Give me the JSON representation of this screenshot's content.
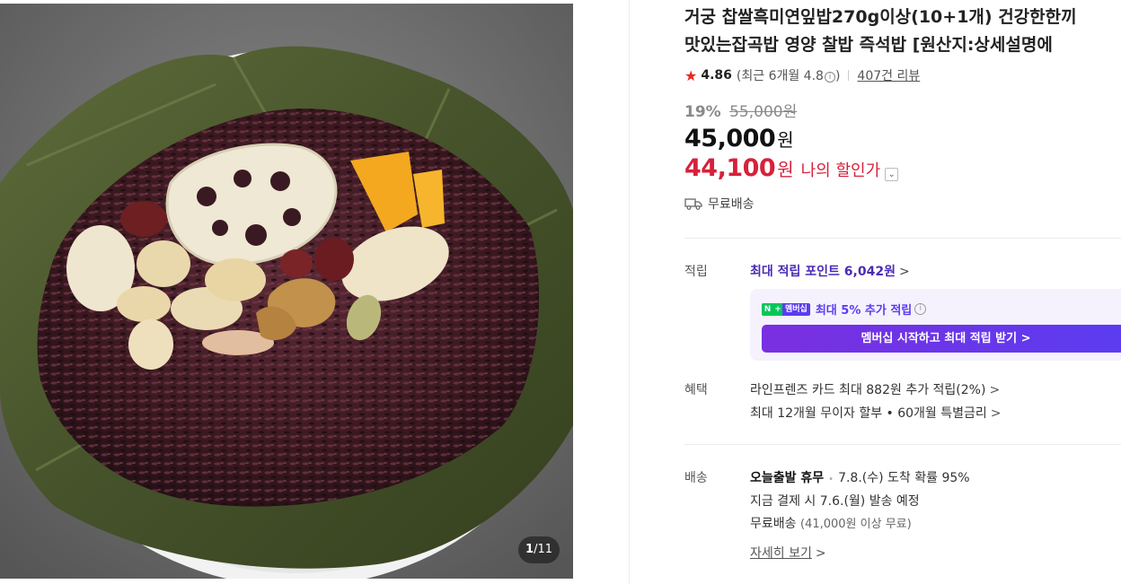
{
  "gallery": {
    "image_desc_icon": "lotus-leaf-rice-photo",
    "counter_current": "1",
    "counter_total": "/11"
  },
  "product": {
    "title_line1": "거궁 찹쌀흑미연잎밥270g이상(10+1개) 건강한한끼",
    "title_line2": "맛있는잡곡밥 영양 찰밥 즉석밥 [원산지:상세설명에",
    "rating": {
      "icon": "star-icon",
      "score": "4.86",
      "recent_prefix": "(최근 6개월 4.8",
      "recent_suffix": ")",
      "info_icon": "i",
      "review_count": "407건 리뷰"
    },
    "discount_rate": "19%",
    "original_price": "55,000원",
    "price": "45,000",
    "price_unit": "원",
    "my_price": "44,100",
    "my_price_unit": "원",
    "my_price_label": "나의 할인가",
    "shipping_free": "무료배송"
  },
  "points": {
    "label": "적립",
    "max_points_text": "최대 적립 포인트 6,042원",
    "chevron": ">",
    "member_badge_n": "N",
    "member_badge_plus": "+",
    "member_badge_text": "멤버십",
    "member_text": "최대 5% 추가 적립",
    "member_info_icon": "i",
    "member_cta": "멤버십 시작하고 최대 적립 받기 >"
  },
  "benefits": {
    "label": "혜택",
    "line1": "라인프렌즈 카드 최대 882원 추가 적립(2%)",
    "line2": "최대 12개월 무이자 할부 • 60개월 특별금리",
    "chevron": ">"
  },
  "delivery": {
    "label": "배송",
    "today_label": "오늘출발 휴무",
    "dot": "•",
    "arrival": "7.8.(수) 도착 확률 95%",
    "ship_line": "지금 결제 시 7.6.(월) 발송 예정",
    "free_label": "무료배송",
    "free_condition": "(41,000원 이상 무료)",
    "more_link": "자세히 보기",
    "chevron": ">"
  },
  "colors": {
    "accent_red": "#d7213b",
    "accent_purple": "#5b3cf0",
    "naver_green": "#03c75a"
  }
}
